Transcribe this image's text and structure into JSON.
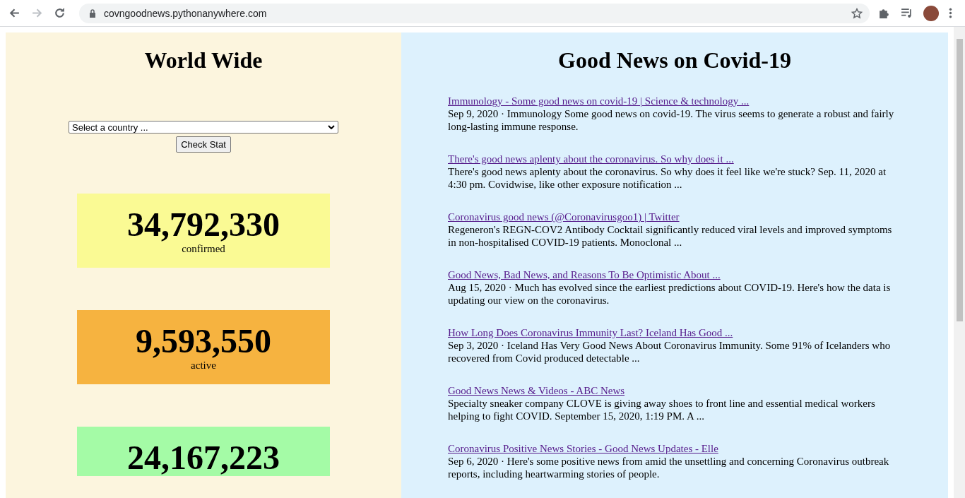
{
  "browser": {
    "address": "covngoodnews.pythonanywhere.com"
  },
  "world": {
    "title": "World Wide",
    "select": {
      "value": "Select a country ..."
    },
    "button": "Check Stat",
    "stats": [
      {
        "number": "34,792,330",
        "label": "confirmed",
        "color": "#fafa94"
      },
      {
        "number": "9,593,550",
        "label": "active",
        "color": "#f6b340"
      },
      {
        "number": "24,167,223",
        "color": "#a4fba6"
      }
    ]
  },
  "news": {
    "title": "Good News on Covid-19",
    "items": [
      {
        "link": "Immunology - Some good news on covid-19 | Science & technology ...",
        "text": "Sep 9, 2020 · Immunology Some good news on covid-19. The virus seems to generate a robust and fairly long-lasting immune response."
      },
      {
        "link": "There's good news aplenty about the coronavirus. So why does it ...",
        "text": "There's good news aplenty about the coronavirus. So why does it feel like we're stuck? Sep. 11, 2020 at 4:30 pm. Covidwise, like other exposure notification ..."
      },
      {
        "link": "Coronavirus good news (@Coronavirusgoo1) | Twitter",
        "text": "Regeneron's REGN-COV2 Antibody Cocktail significantly reduced viral levels and improved symptoms in non-hospitalised COVID-19 patients. Monoclonal ..."
      },
      {
        "link": "Good News, Bad News, and Reasons To Be Optimistic About ...",
        "text": "Aug 15, 2020 · Much has evolved since the earliest predictions about COVID-19. Here's how the data is updating our view on the coronavirus."
      },
      {
        "link": "How Long Does Coronavirus Immunity Last? Iceland Has Good ...",
        "text": "Sep 3, 2020 · Iceland Has Very Good News About Coronavirus Immunity. Some 91% of Icelanders who recovered from Covid produced detectable ..."
      },
      {
        "link": "Good News News & Videos - ABC News",
        "text": "Specialty sneaker company CLOVE is giving away shoes to front line and essential medical workers helping to fight COVID. September 15, 2020, 1:19 PM. A ..."
      },
      {
        "link": "Coronavirus Positive News Stories - Good News Updates - Elle",
        "text": "Sep 6, 2020 · Here's some positive news from amid the unsettling and concerning Coronavirus outbreak reports, including heartwarming stories of people."
      }
    ]
  }
}
